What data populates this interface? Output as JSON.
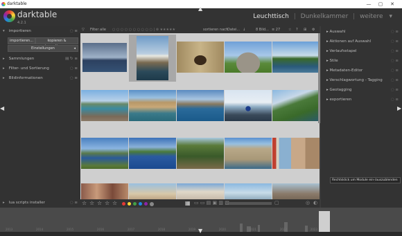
{
  "window": {
    "title": "darktable"
  },
  "header": {
    "app_name": "darktable",
    "version": "4.2.1",
    "views": [
      "Leuchttisch",
      "Dunkelkammer",
      "weitere"
    ],
    "view_sep": "|",
    "views_dropdown": "▾"
  },
  "left_panel": {
    "import": {
      "label": "importieren",
      "btn_import": "importieren...",
      "btn_copy": "kopieren & importieren...",
      "settings": "Einstellungen"
    },
    "modules": [
      "Sammlungen",
      "Filter- und Sortierung",
      "Bildinformationen"
    ],
    "lua": "lua scripts installer"
  },
  "top_toolbar": {
    "filter_label": "Filter",
    "filter_value": "alle",
    "sort_label": "sortieren nach",
    "sort_value": "Datei...",
    "count": "8 Bild...",
    "count2": "≡ 27"
  },
  "right_panel": {
    "modules": [
      "Auswahl",
      "Aktionen auf Auswahl",
      "Verlaufsstapel",
      "Stile",
      "Metadaten-Editor",
      "Verschlagwortung - Tagging",
      "Geotagging",
      "exportieren"
    ]
  },
  "bottom_toolbar": {
    "stars": [
      "☆",
      "☆",
      "☆",
      "☆",
      "☆"
    ],
    "color_labels": [
      "#e53935",
      "#fdd835",
      "#43a047",
      "#1e88e5",
      "#8e24aa",
      "#888888"
    ]
  },
  "tooltip": "Rechtsklick um Module ein-/auszublenden",
  "timeline": {
    "labels": [
      "2013",
      "2014",
      "2015",
      "2016",
      "2017",
      "2018",
      "2019",
      "2020",
      "2021",
      "2022",
      "2023"
    ]
  },
  "colors": {
    "accent": "#e0e0e0",
    "panel": "#333333",
    "grid_bg": "#cfcfcf"
  },
  "thumbnails": [
    [
      "storm-sea",
      "boat",
      "gate",
      "stone-hut",
      "coast-trees"
    ],
    [
      "rocky-beach",
      "cliff-water",
      "bay-rocks",
      "snorkel-rocks",
      "green-hills"
    ],
    [
      "sea-hills",
      "boat-bay",
      "palm-trees",
      "castle",
      "lighthouse-canal"
    ],
    [
      "town-street",
      "harbor-town",
      "plaza",
      "pier",
      "ruins"
    ]
  ]
}
